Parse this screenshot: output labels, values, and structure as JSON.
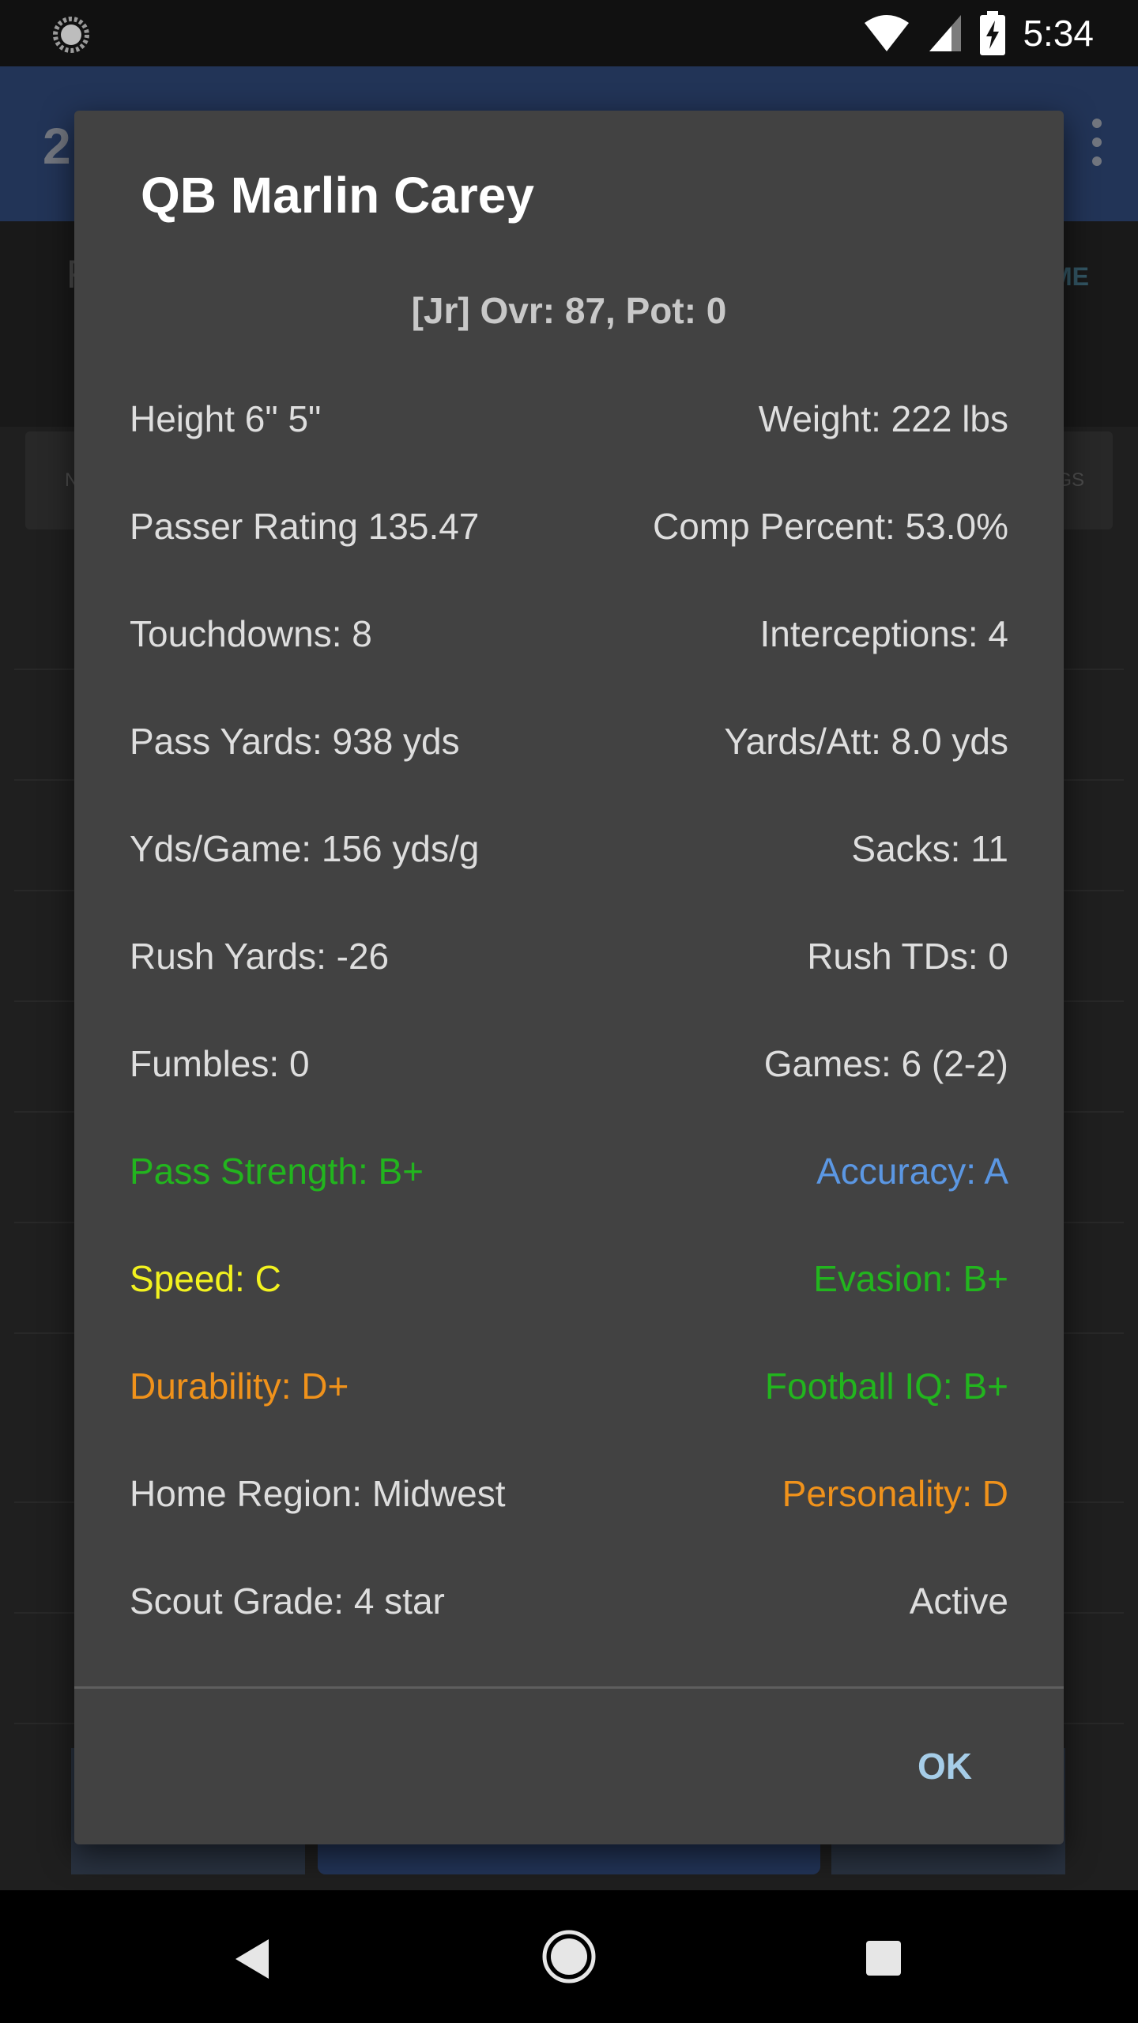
{
  "status_bar": {
    "time": "5:34",
    "icons": [
      "loading-spinner-icon",
      "wifi-icon",
      "cell-signal-icon",
      "battery-charging-icon"
    ]
  },
  "background_app": {
    "app_bar_title_fragment": "2",
    "subheader_fragment": "F",
    "right_action_fragment": "ME",
    "tab_left_fragment": "N",
    "tab_right_fragment": "GS",
    "accent_color": "#3e5f9e"
  },
  "dialog": {
    "title": "QB Marlin Carey",
    "subtitle": "[Jr] Ovr: 87, Pot: 0",
    "rows": [
      {
        "left": "Height 6\" 5\"",
        "right": "Weight: 222 lbs",
        "left_color": "#dedede",
        "right_color": "#dedede"
      },
      {
        "left": "Passer Rating 135.47",
        "right": "Comp Percent: 53.0%",
        "left_color": "#dedede",
        "right_color": "#dedede"
      },
      {
        "left": "Touchdowns: 8",
        "right": "Interceptions: 4",
        "left_color": "#dedede",
        "right_color": "#dedede"
      },
      {
        "left": "Pass Yards: 938 yds",
        "right": "Yards/Att: 8.0 yds",
        "left_color": "#dedede",
        "right_color": "#dedede"
      },
      {
        "left": "Yds/Game: 156 yds/g",
        "right": "Sacks: 11",
        "left_color": "#dedede",
        "right_color": "#dedede"
      },
      {
        "left": "Rush Yards: -26",
        "right": "Rush TDs: 0",
        "left_color": "#dedede",
        "right_color": "#dedede"
      },
      {
        "left": "Fumbles: 0",
        "right": "Games: 6 (2-2)",
        "left_color": "#dedede",
        "right_color": "#dedede"
      },
      {
        "left": "Pass Strength: B+",
        "right": "Accuracy: A",
        "left_color": "#22b51e",
        "right_color": "#5b97e3"
      },
      {
        "left": "Speed: C",
        "right": "Evasion: B+",
        "left_color": "#f2f21f",
        "right_color": "#22b51e"
      },
      {
        "left": "Durability: D+",
        "right": "Football IQ: B+",
        "left_color": "#f0921b",
        "right_color": "#22b51e"
      },
      {
        "left": "Home Region: Midwest",
        "right": "Personality: D",
        "left_color": "#dedede",
        "right_color": "#f0921b"
      },
      {
        "left": "Scout Grade: 4 star",
        "right": "Active",
        "left_color": "#dedede",
        "right_color": "#dedede"
      }
    ],
    "ok_label": "OK"
  },
  "nav_bar": {
    "icons": [
      "back-icon",
      "home-icon",
      "recents-icon"
    ]
  }
}
